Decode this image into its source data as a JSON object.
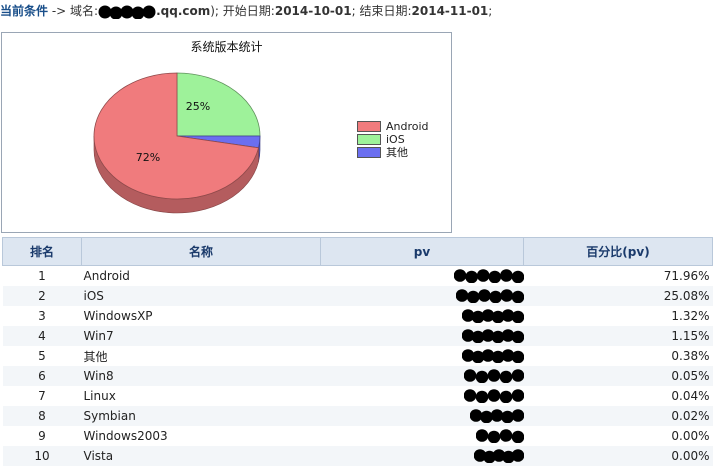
{
  "header": {
    "condition_label": "当前条件",
    "arrow": " -> ",
    "domain_label": "域名:",
    "domain_suffix": ".qq.com",
    "domain_tail": "); ",
    "start_label": "开始日期:",
    "start_date": "2014-10-01",
    "sep": "; ",
    "end_label": "结束日期:",
    "end_date": "2014-11-01",
    "end_tail": ";"
  },
  "chart_data": {
    "type": "pie",
    "title": "系统版本统计",
    "labels": [
      "Android",
      "iOS",
      "其他"
    ],
    "values": [
      72,
      25,
      3
    ],
    "data_labels": [
      "72%",
      "25%"
    ],
    "colors": [
      "#f07b7d",
      "#9ef29a",
      "#6b6ff0"
    ],
    "legend_position": "right"
  },
  "table": {
    "headers": [
      "排名",
      "名称",
      "pv",
      "百分比(pv)"
    ],
    "rows": [
      {
        "rank": "1",
        "name": "Android",
        "pct": "71.96%"
      },
      {
        "rank": "2",
        "name": "iOS",
        "pct": "25.08%"
      },
      {
        "rank": "3",
        "name": "WindowsXP",
        "pct": "1.32%"
      },
      {
        "rank": "4",
        "name": "Win7",
        "pct": "1.15%"
      },
      {
        "rank": "5",
        "name": "其他",
        "pct": "0.38%"
      },
      {
        "rank": "6",
        "name": "Win8",
        "pct": "0.05%"
      },
      {
        "rank": "7",
        "name": "Linux",
        "pct": "0.04%"
      },
      {
        "rank": "8",
        "name": "Symbian",
        "pct": "0.02%"
      },
      {
        "rank": "9",
        "name": "Windows2003",
        "pct": "0.00%"
      },
      {
        "rank": "10",
        "name": "Vista",
        "pct": "0.00%"
      }
    ]
  }
}
